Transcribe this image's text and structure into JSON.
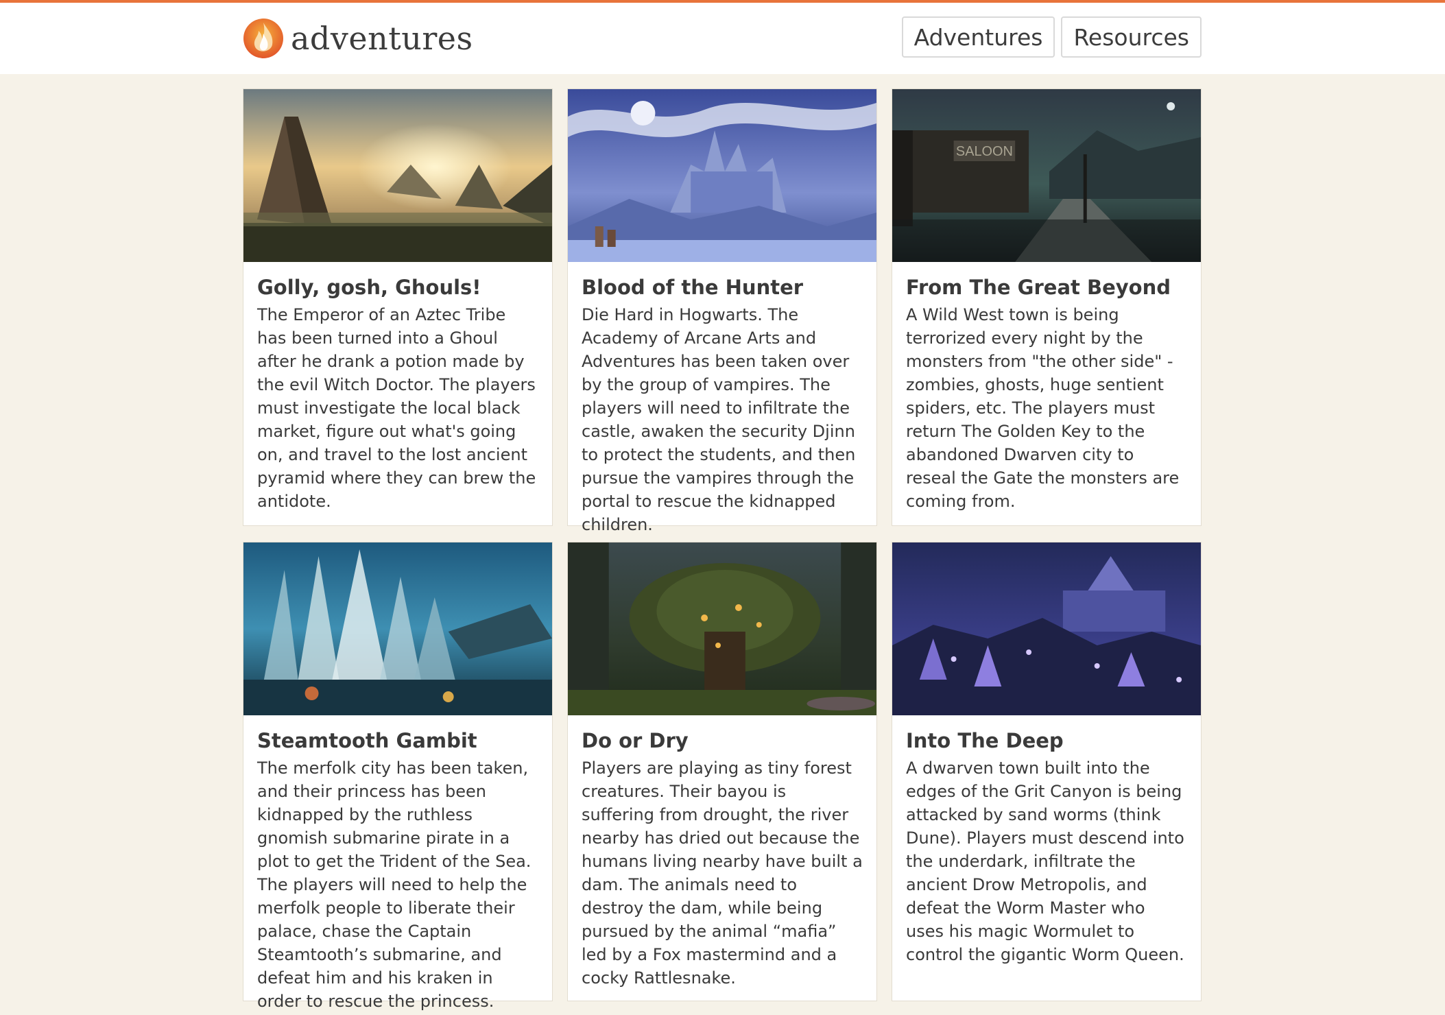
{
  "header": {
    "logo_text": "adventures",
    "nav": [
      {
        "label": "Adventures"
      },
      {
        "label": "Resources"
      }
    ]
  },
  "colors": {
    "accent": "#e8743b",
    "background": "#f6f2e8"
  },
  "cards": [
    {
      "title": "Golly, gosh, Ghouls!",
      "description": "The Emperor of an Aztec Tribe has been turned into a Ghoul after he drank a potion made by the evil Witch Doctor. The players must investigate the local black market, figure out what's going on, and travel to the lost ancient pyramid where they can brew the antidote."
    },
    {
      "title": "Blood of the Hunter",
      "description": "Die Hard in Hogwarts. The Academy of Arcane Arts and Adventures has been taken over by the group of vampires. The players will need to infiltrate the castle, awaken the security Djinn to protect the students, and then pursue the vampires through the portal to rescue the kidnapped children."
    },
    {
      "title": "From The Great Beyond",
      "description": "A Wild West town is being terrorized every night by the monsters from \"the other side\" - zombies, ghosts, huge sentient spiders, etc. The players must return The Golden Key to the abandoned Dwarven city to reseal the Gate the monsters are coming from.",
      "image_sign": "SALOON"
    },
    {
      "title": "Steamtooth Gambit",
      "description": "The merfolk city has been taken, and their princess has been kidnapped by the ruthless gnomish submarine pirate in a plot to get the Trident of the Sea. The players will need to help the merfolk people to liberate their palace, chase the Captain Steamtooth’s submarine, and defeat him and his kraken in order to rescue the princess."
    },
    {
      "title": "Do or Dry",
      "description": "Players are playing as tiny forest creatures. Their bayou is suffering from drought, the river nearby has dried out because the humans living nearby have built a dam. The animals need to destroy the dam, while being pursued by the animal “mafia” led by a Fox mastermind and a cocky Rattlesnake."
    },
    {
      "title": "Into The Deep",
      "description": "A dwarven town built into the edges of the Grit Canyon is being attacked by sand worms (think Dune). Players must descend into the underdark, infiltrate the ancient Drow Metropolis, and defeat the Worm Master who uses his magic Wormulet to control the gigantic Worm Queen."
    }
  ]
}
